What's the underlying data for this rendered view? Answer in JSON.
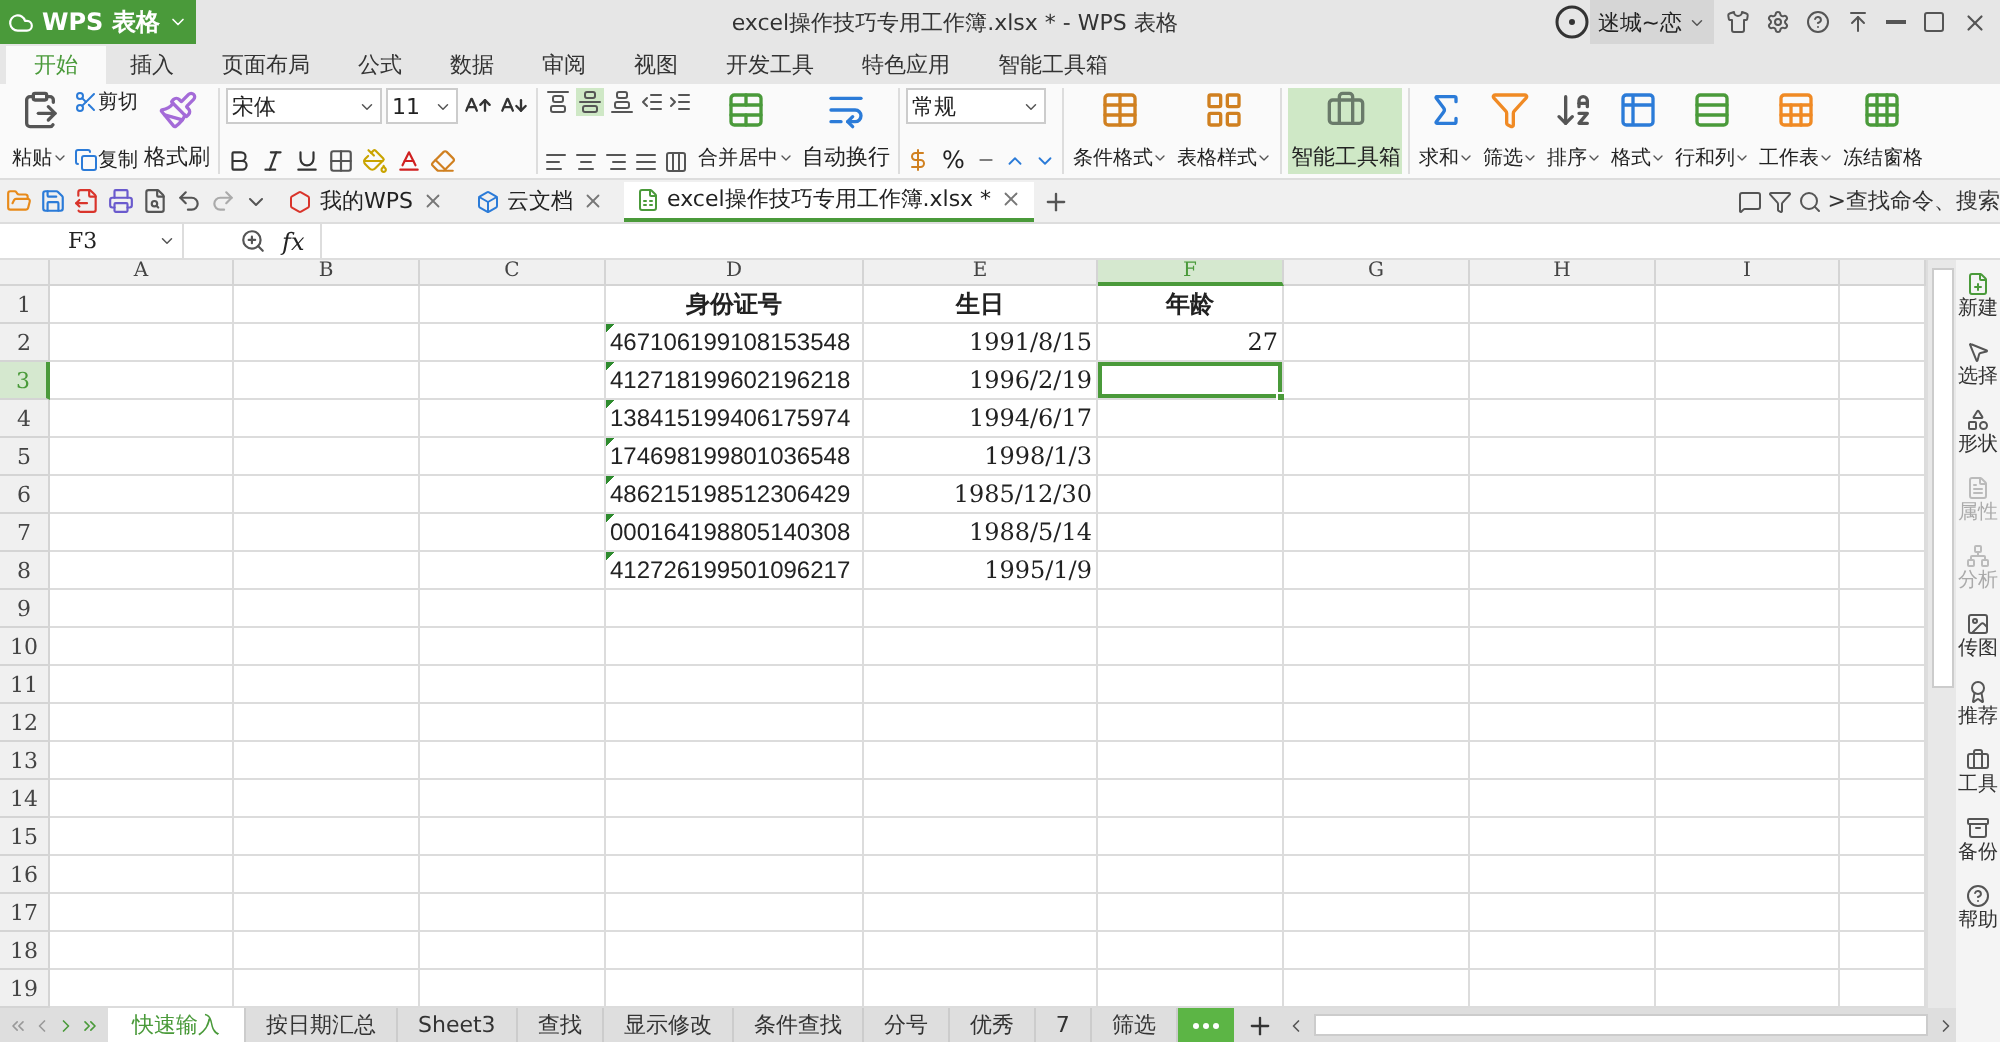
{
  "title_bar": {
    "app_button": "WPS 表格",
    "title": "excel操作技巧专用工作簿.xlsx * - WPS 表格",
    "user": "迷城~恋"
  },
  "menu_tabs": [
    {
      "label": "开始",
      "selected": true
    },
    {
      "label": "插入",
      "selected": false
    },
    {
      "label": "页面布局",
      "selected": false
    },
    {
      "label": "公式",
      "selected": false
    },
    {
      "label": "数据",
      "selected": false
    },
    {
      "label": "审阅",
      "selected": false
    },
    {
      "label": "视图",
      "selected": false
    },
    {
      "label": "开发工具",
      "selected": false
    },
    {
      "label": "特色应用",
      "selected": false
    },
    {
      "label": "智能工具箱",
      "selected": false
    }
  ],
  "ribbon": {
    "clipboard": {
      "paste": "粘贴",
      "cut": "剪切",
      "copy": "复制",
      "format_painter": "格式刷"
    },
    "font": {
      "name": "宋体",
      "size": "11"
    },
    "alignment": {
      "vertical": [
        {
          "selected": false
        },
        {
          "selected": true
        },
        {
          "selected": false
        }
      ],
      "merge": "合并居中",
      "wrap": "自动换行"
    },
    "number": {
      "format": "常规",
      "percent": "%"
    },
    "styles": [
      "条件格式",
      "表格样式"
    ],
    "toolbox": {
      "label": "智能工具箱",
      "selected": true
    },
    "commands": [
      "求和",
      "筛选",
      "排序",
      "格式",
      "行和列",
      "工作表",
      "冻结窗格"
    ]
  },
  "quick_bar": {
    "doc_tabs": [
      {
        "label": "我的WPS",
        "selected": false
      },
      {
        "label": "云文档",
        "selected": false
      },
      {
        "label": "excel操作技巧专用工作簿.xlsx *",
        "selected": true
      }
    ],
    "search": {
      "placeholder": ">查找命令、搜索"
    }
  },
  "formula_bar": {
    "name_box": "F3",
    "fx": "fx"
  },
  "sheet": {
    "columns": [
      {
        "label": "A",
        "selected": false
      },
      {
        "label": "B",
        "selected": false
      },
      {
        "label": "C",
        "selected": false
      },
      {
        "label": "D",
        "selected": false
      },
      {
        "label": "E",
        "selected": false
      },
      {
        "label": "F",
        "selected": true
      },
      {
        "label": "G",
        "selected": false
      },
      {
        "label": "H",
        "selected": false
      },
      {
        "label": "I",
        "selected": false
      }
    ],
    "rows": [
      {
        "number": "1",
        "selected": false,
        "kind": "header",
        "d": "身份证号",
        "e": "生日",
        "f": "年龄"
      },
      {
        "number": "2",
        "selected": false,
        "kind": "data",
        "d": "467106199108153548",
        "e": "1991/8/15",
        "f": "27"
      },
      {
        "number": "3",
        "selected": true,
        "kind": "data",
        "d": "412718199602196218",
        "e": "1996/2/19"
      },
      {
        "number": "4",
        "selected": false,
        "kind": "data",
        "d": "138415199406175974",
        "e": "1994/6/17"
      },
      {
        "number": "5",
        "selected": false,
        "kind": "data",
        "d": "174698199801036548",
        "e": "1998/1/3"
      },
      {
        "number": "6",
        "selected": false,
        "kind": "data",
        "d": "486215198512306429",
        "e": "1985/12/30"
      },
      {
        "number": "7",
        "selected": false,
        "kind": "data",
        "d": "000164198805140308",
        "e": "1988/5/14"
      },
      {
        "number": "8",
        "selected": false,
        "kind": "data",
        "d": "412726199501096217",
        "e": "1995/1/9"
      },
      {
        "number": "9",
        "selected": false
      },
      {
        "number": "10",
        "selected": false
      },
      {
        "number": "11",
        "selected": false
      },
      {
        "number": "12",
        "selected": false
      },
      {
        "number": "13",
        "selected": false
      },
      {
        "number": "14",
        "selected": false
      },
      {
        "number": "15",
        "selected": false
      },
      {
        "number": "16",
        "selected": false
      },
      {
        "number": "17",
        "selected": false
      },
      {
        "number": "18",
        "selected": false
      },
      {
        "number": "19",
        "selected": false
      }
    ]
  },
  "side_panel": [
    {
      "label": "新建",
      "disabled": false
    },
    {
      "label": "选择",
      "disabled": false
    },
    {
      "label": "形状",
      "disabled": false
    },
    {
      "label": "属性",
      "disabled": true
    },
    {
      "label": "分析",
      "disabled": true
    },
    {
      "label": "传图",
      "disabled": false
    },
    {
      "label": "推荐",
      "disabled": false
    },
    {
      "label": "工具",
      "disabled": false
    },
    {
      "label": "备份",
      "disabled": false
    },
    {
      "label": "帮助",
      "disabled": false
    }
  ],
  "sheet_tabs": [
    {
      "label": "快速输入",
      "selected": true
    },
    {
      "label": "按日期汇总",
      "selected": false
    },
    {
      "label": "Sheet3",
      "selected": false
    },
    {
      "label": "查找",
      "selected": false
    },
    {
      "label": "显示修改",
      "selected": false
    },
    {
      "label": "条件查找",
      "selected": false
    },
    {
      "label": "分号",
      "selected": false
    },
    {
      "label": "优秀",
      "selected": false
    },
    {
      "label": "7",
      "selected": false
    },
    {
      "label": "筛选",
      "selected": false
    }
  ]
}
